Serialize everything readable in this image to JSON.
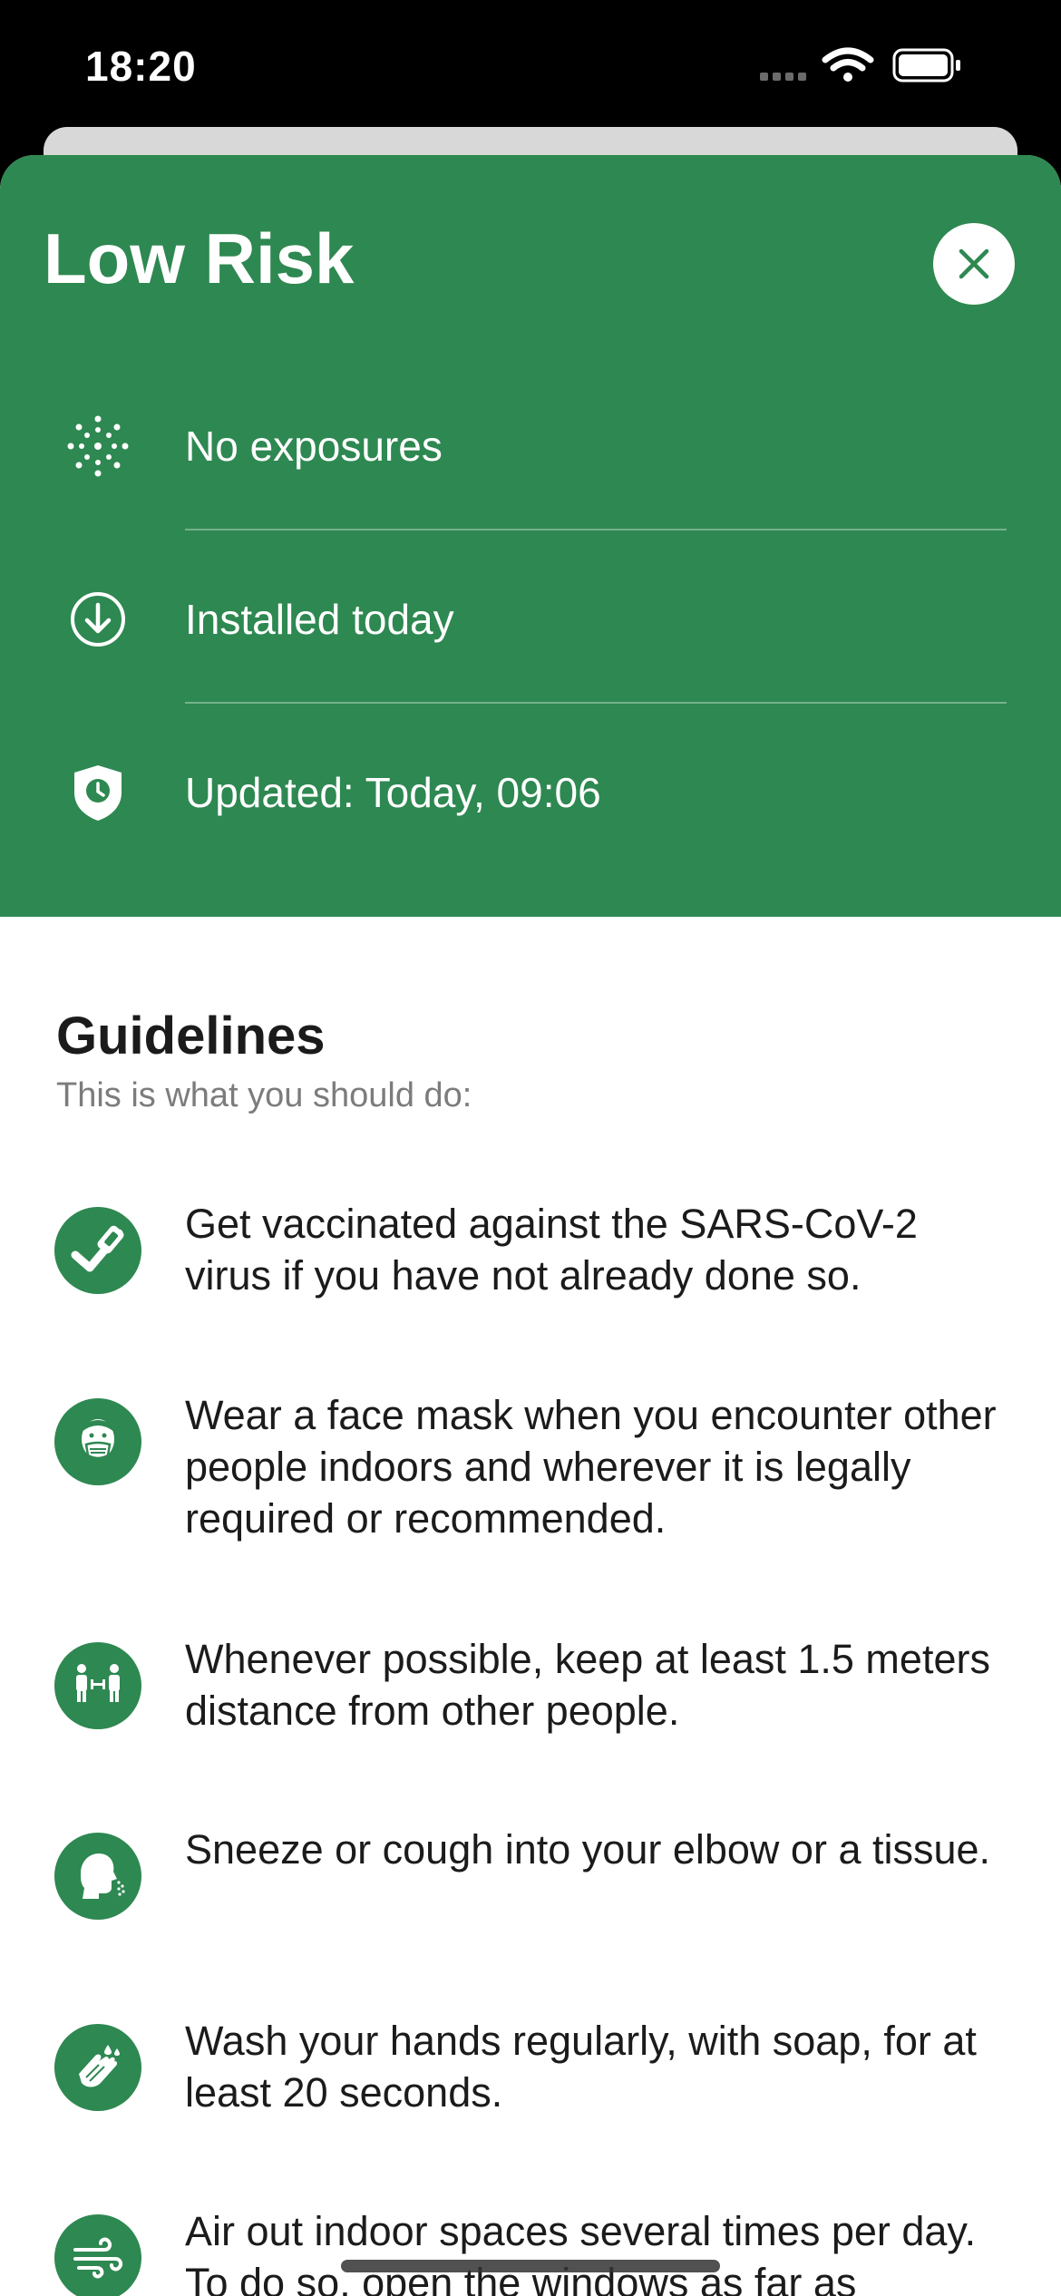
{
  "status_bar": {
    "time": "18:20"
  },
  "header": {
    "title": "Low Risk",
    "close_icon": "close-icon",
    "background_color": "#2e8851",
    "rows": [
      {
        "icon": "virus-icon",
        "label": "No exposures"
      },
      {
        "icon": "download-icon",
        "label": "Installed today"
      },
      {
        "icon": "shield-clock-icon",
        "label": "Updated: Today, 09:06"
      }
    ]
  },
  "guidelines": {
    "title": "Guidelines",
    "subtitle": "This is what you should do:",
    "items": [
      {
        "icon": "vaccine-icon",
        "text": "Get vaccinated against the SARS-CoV-2 virus if you have not already done so."
      },
      {
        "icon": "face-mask-icon",
        "text": "Wear a face mask when you encounter other people indoors and wherever it is legally required or recommended."
      },
      {
        "icon": "distance-icon",
        "text": "Whenever possible, keep at least 1.5 meters distance from other people."
      },
      {
        "icon": "sneeze-icon",
        "text": "Sneeze or cough into your elbow or a tissue."
      },
      {
        "icon": "hand-wash-icon",
        "text": "Wash your hands regularly, with soap, for at least 20 seconds."
      },
      {
        "icon": "ventilation-icon",
        "text": "Air out indoor spaces several times per day. To do so, open the windows as far as"
      }
    ]
  }
}
